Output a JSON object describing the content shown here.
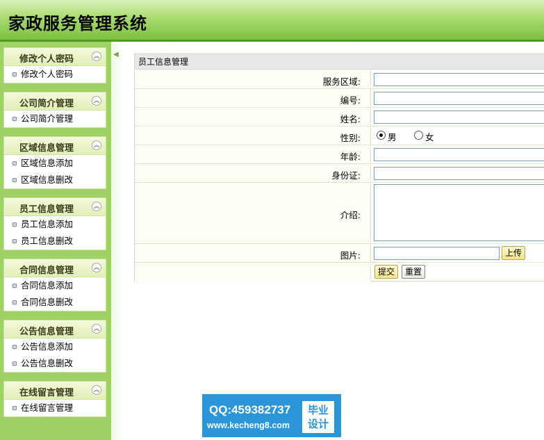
{
  "header": {
    "title": "家政服务管理系统"
  },
  "sidebar": {
    "groups": [
      {
        "title": "修改个人密码",
        "items": [
          "修改个人密码"
        ]
      },
      {
        "title": "公司简介管理",
        "items": [
          "公司简介管理"
        ]
      },
      {
        "title": "区域信息管理",
        "items": [
          "区域信息添加",
          "区域信息删改"
        ]
      },
      {
        "title": "员工信息管理",
        "items": [
          "员工信息添加",
          "员工信息删改"
        ]
      },
      {
        "title": "合同信息管理",
        "items": [
          "合同信息添加",
          "合同信息删改"
        ]
      },
      {
        "title": "公告信息管理",
        "items": [
          "公告信息添加",
          "公告信息删改"
        ]
      },
      {
        "title": "在线留言管理",
        "items": [
          "在线留言管理"
        ]
      }
    ]
  },
  "form": {
    "title": "员工信息管理",
    "labels": {
      "area": "服务区域:",
      "code": "编号:",
      "name": "姓名:",
      "gender": "性别:",
      "age": "年龄:",
      "idcard": "身份证:",
      "intro": "介绍:",
      "photo": "图片:"
    },
    "gender_options": {
      "male": "男",
      "female": "女",
      "selected": "男"
    },
    "values": {
      "area": "",
      "code": "",
      "name": "",
      "age": "",
      "idcard": "",
      "intro": "",
      "photo": ""
    },
    "buttons": {
      "upload": "上传",
      "submit": "提交",
      "reset": "重置"
    }
  },
  "watermark": {
    "qq": "QQ:459382737",
    "url": "www.kecheng8.com",
    "badge_line1": "毕业",
    "badge_line2": "设计"
  },
  "colors": {
    "header_green": "#7cc043",
    "sidebar_green": "#9fd165",
    "watermark_blue": "#2a95d8"
  }
}
